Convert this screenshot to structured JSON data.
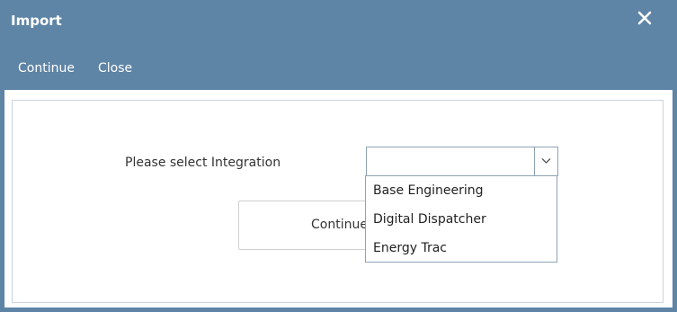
{
  "window": {
    "title": "Import"
  },
  "toolbar": {
    "continue_label": "Continue",
    "close_label": "Close"
  },
  "form": {
    "integration_label": "Please select Integration",
    "integration_value": "",
    "continue_button_label": "Continue"
  },
  "dropdown": {
    "options": [
      {
        "label": "Base Engineering"
      },
      {
        "label": "Digital Dispatcher"
      },
      {
        "label": "Energy Trac"
      }
    ]
  },
  "icons": {
    "close": "close-icon",
    "chevron": "chevron-down-icon"
  },
  "colors": {
    "header": "#5e84a6",
    "border": "#8fa3b6",
    "text": "#333333"
  }
}
